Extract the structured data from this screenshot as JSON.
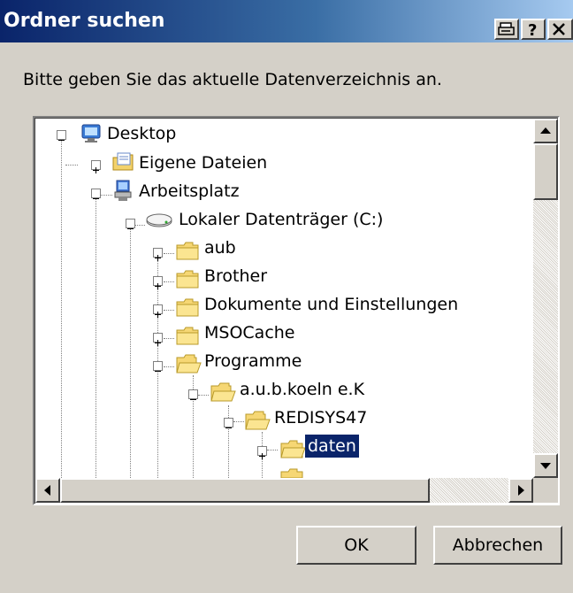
{
  "window": {
    "title": "Ordner suchen",
    "buttons": {
      "print_icon": "printer-icon",
      "help": "?",
      "close": "X"
    }
  },
  "instruction": "Bitte geben Sie das aktuelle Datenverzeichnis an.",
  "tree": {
    "items": [
      {
        "label": "Desktop",
        "icon": "desktop-icon",
        "expander": "minus"
      },
      {
        "label": "Eigene Dateien",
        "icon": "my-documents-icon",
        "expander": "plus"
      },
      {
        "label": "Arbeitsplatz",
        "icon": "my-computer-icon",
        "expander": "minus"
      },
      {
        "label": "Lokaler Datenträger (C:)",
        "icon": "drive-icon",
        "expander": "minus"
      },
      {
        "label": "aub",
        "icon": "folder-icon",
        "expander": "plus"
      },
      {
        "label": "Brother",
        "icon": "folder-icon",
        "expander": "plus"
      },
      {
        "label": "Dokumente und Einstellungen",
        "icon": "folder-icon",
        "expander": "plus"
      },
      {
        "label": "MSOCache",
        "icon": "folder-icon",
        "expander": "plus"
      },
      {
        "label": "Programme",
        "icon": "open-folder-icon",
        "expander": "minus"
      },
      {
        "label": "a.u.b.koeln e.K",
        "icon": "open-folder-icon",
        "expander": "minus"
      },
      {
        "label": "REDISYS47",
        "icon": "open-folder-icon",
        "expander": "minus"
      },
      {
        "label": "daten",
        "icon": "folder-icon",
        "expander": "plus",
        "selected": true
      }
    ]
  },
  "buttons": {
    "ok": "OK",
    "cancel": "Abbrechen"
  },
  "colors": {
    "title_bar": "#0a246a",
    "dialog_bg": "#d4d0c8",
    "selection": "#0a246a"
  }
}
